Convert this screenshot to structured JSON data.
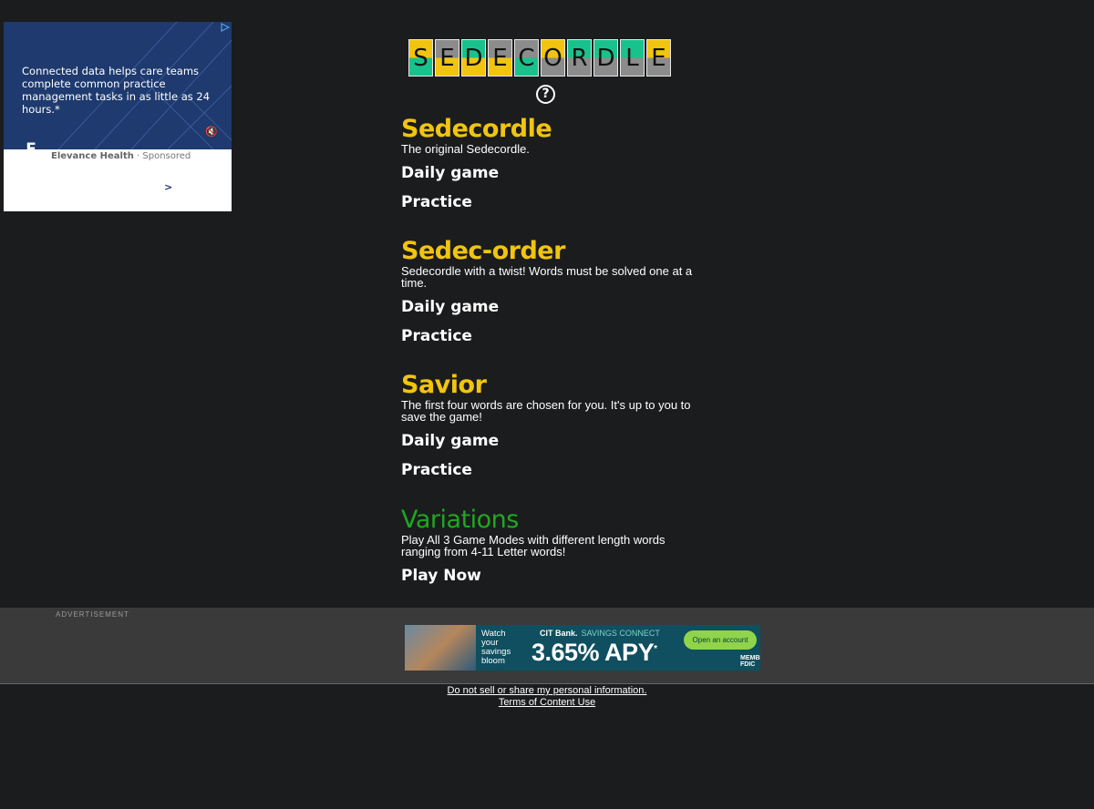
{
  "side_ad": {
    "text": "Connected data helps care teams complete common practice management tasks in as little as 24 hours.*",
    "brand": "Elevance Health",
    "sponsored": "Sponsored",
    "logo_letter": "E",
    "arrow": ">",
    "mute_icon": "speaker-muted-icon",
    "colors": {
      "panel": "#1e3a6e"
    }
  },
  "logo": {
    "letters": [
      "S",
      "E",
      "D",
      "E",
      "C",
      "O",
      "R",
      "D",
      "L",
      "E"
    ],
    "tile_colors": {
      "grey": "#8c8c8c",
      "yellow": "#f1c40f",
      "green": "#19c28c"
    }
  },
  "help_icon": "help-circle-icon",
  "sections": [
    {
      "title": "Sedecordle",
      "desc": "The original Sedecordle.",
      "links": [
        "Daily game",
        "Practice"
      ]
    },
    {
      "title": "Sedec-order",
      "desc": "Sedecordle with a twist! Words must be solved one at a time.",
      "links": [
        "Daily game",
        "Practice"
      ]
    },
    {
      "title": "Savior",
      "desc": "The first four words are chosen for you. It's up to you to save the game!",
      "links": [
        "Daily game",
        "Practice"
      ]
    },
    {
      "title": "Variations",
      "desc": "Play All 3 Game Modes with different length words ranging from 4-11 Letter words!",
      "links": [
        "Play Now"
      ]
    }
  ],
  "ad_bar": {
    "label": "ADVERTISEMENT",
    "banner": {
      "watch": "Watch your savings bloom",
      "bank": "CIT Bank.",
      "connect": "SAVINGS CONNECT",
      "apy": "3.65% APY",
      "apy_mark": "*",
      "cta": "Open an account",
      "fdic": "MEMBER FDIC"
    }
  },
  "footer": {
    "privacy": "Do not sell or share my personal information.",
    "terms": "Terms of Content Use"
  },
  "colors": {
    "background": "#1b1c1e",
    "title_yellow": "#f1c40f",
    "title_green": "#1fa81f"
  }
}
